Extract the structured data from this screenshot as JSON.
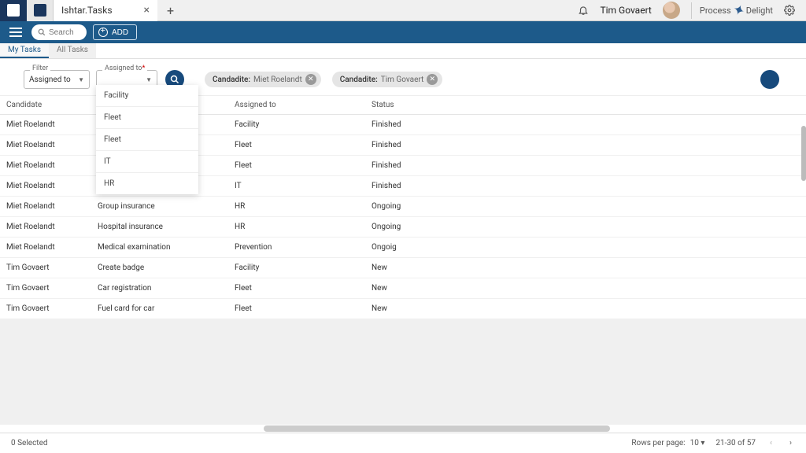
{
  "tab": {
    "title": "Ishtar.Tasks"
  },
  "header": {
    "user": "Tim Govaert",
    "brand1": "Process",
    "brand2": "Delight"
  },
  "toolbar": {
    "search_placeholder": "Search",
    "add_label": "ADD"
  },
  "subtabs": {
    "my": "My Tasks",
    "all": "All Tasks"
  },
  "filter": {
    "label": "Filter",
    "value": "Assigned to",
    "assigned_label": "Assigned to",
    "assigned_value": ""
  },
  "dropdown_options": [
    "Facility",
    "Fleet",
    "Fleet",
    "IT",
    "HR"
  ],
  "chips": [
    {
      "key": "Candadite:",
      "value": "Miet Roelandt"
    },
    {
      "key": "Candadite:",
      "value": "Tim Govaert"
    }
  ],
  "columns": {
    "candidate": "Candidate",
    "task": "",
    "assigned": "Assigned to",
    "status": "Status"
  },
  "rows": [
    {
      "c": "Miet Roelandt",
      "t": "",
      "a": "Facility",
      "s": "Finished"
    },
    {
      "c": "Miet Roelandt",
      "t": "",
      "a": "Fleet",
      "s": "Finished"
    },
    {
      "c": "Miet Roelandt",
      "t": "",
      "a": "Fleet",
      "s": "Finished"
    },
    {
      "c": "Miet Roelandt",
      "t": "",
      "a": "IT",
      "s": "Finished"
    },
    {
      "c": "Miet Roelandt",
      "t": "Group insurance",
      "a": "HR",
      "s": "Ongoing"
    },
    {
      "c": "Miet Roelandt",
      "t": "Hospital insurance",
      "a": "HR",
      "s": "Ongoing"
    },
    {
      "c": "Miet Roelandt",
      "t": "Medical examination",
      "a": "Prevention",
      "s": "Ongoig"
    },
    {
      "c": "Tim Govaert",
      "t": "Create badge",
      "a": "Facility",
      "s": "New"
    },
    {
      "c": "Tim Govaert",
      "t": "Car registration",
      "a": "Fleet",
      "s": "New"
    },
    {
      "c": "Tim Govaert",
      "t": "Fuel card for car",
      "a": "Fleet",
      "s": "New"
    }
  ],
  "footer": {
    "selected": "0 Selected",
    "rpp_label": "Rows per page:",
    "rpp_value": "10",
    "range": "21-30 of 57"
  }
}
